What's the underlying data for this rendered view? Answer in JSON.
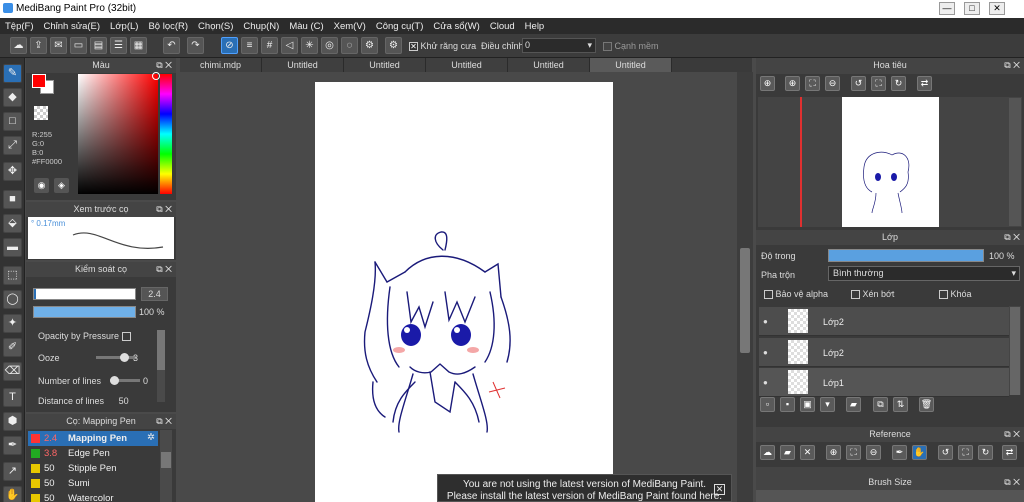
{
  "window": {
    "title": "MediBang Paint Pro (32bit)",
    "minimize": "—",
    "maximize": "□",
    "close": "✕"
  },
  "menu": [
    "Tệp(F)",
    "Chỉnh sửa(E)",
    "Lớp(L)",
    "Bộ lọc(R)",
    "Chọn(S)",
    "Chụp(N)",
    "Màu (C)",
    "Xem(V)",
    "Công cụ(T)",
    "Cửa sổ(W)",
    "Cloud",
    "Help"
  ],
  "toolbar": {
    "antialias_label": "Khử răng cưa",
    "adjust_label": "Điều chỉnh",
    "adjust_value": "0",
    "smooth_label": "Cạnh mềm"
  },
  "tabs": [
    "chimi.mdp",
    "Untitled",
    "Untitled",
    "Untitled",
    "Untitled",
    "Untitled"
  ],
  "color_panel": {
    "title": "Màu",
    "r": "R:255",
    "g": "G:0",
    "b": "B:0",
    "hex": "#FF0000",
    "fg_color": "#ff0000",
    "bg_color": "#ffffff"
  },
  "brush_preview": {
    "title": "Xem trước cọ",
    "size": "0.17mm"
  },
  "brush_control": {
    "title": "Kiểm soát cọ",
    "size_value": "2.4",
    "opacity_value": "100 %",
    "opacity_by_pressure": "Opacity by Pressure",
    "ooze_label": "Ooze",
    "ooze_value": "3",
    "lines_label": "Number of lines",
    "lines_value": "0",
    "distance_label": "Distance of lines",
    "distance_value": "50"
  },
  "brush_list": {
    "title": "Cọ: Mapping Pen",
    "items": [
      {
        "size": "2.4",
        "name": "Mapping Pen",
        "color": "#ff3333",
        "selected": true
      },
      {
        "size": "3.8",
        "name": "Edge Pen",
        "color": "#22aa22"
      },
      {
        "size": "50",
        "name": "Stipple Pen",
        "color": "#e8c800"
      },
      {
        "size": "50",
        "name": "Sumi",
        "color": "#e8c800"
      },
      {
        "size": "50",
        "name": "Watercolor",
        "color": "#e8c800"
      }
    ]
  },
  "navigator": {
    "title": "Hoa tiêu"
  },
  "layer_panel": {
    "title": "Lớp",
    "opacity_label": "Độ trong",
    "opacity_value": "100 %",
    "opacity_fraction": 1.0,
    "blend_label": "Pha trộn",
    "blend_value": "Bình thường",
    "protect_alpha": "Bảo vệ alpha",
    "clipping": "Xén bớt",
    "lock": "Khóa",
    "layers": [
      {
        "name": "Lớp2"
      },
      {
        "name": "Lớp2"
      },
      {
        "name": "Lớp1"
      }
    ]
  },
  "reference": {
    "title": "Reference"
  },
  "brush_size_panel": {
    "title": "Brush Size"
  },
  "notice": {
    "line1": "You are not using the latest version of MediBang Paint.",
    "line2": "Please install the latest version of MediBang Paint found here."
  }
}
